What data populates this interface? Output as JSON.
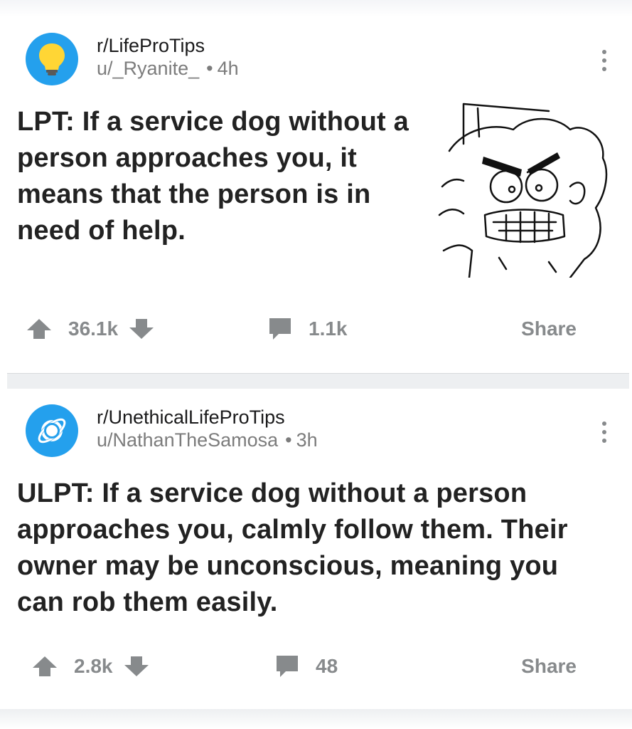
{
  "posts": [
    {
      "subreddit": "r/LifeProTips",
      "user": "u/_Ryanite_",
      "age": "4h",
      "title": "LPT: If a service dog without a person approaches you, it means that the person is in need of help.",
      "upvotes": "36.1k",
      "comments": "1.1k",
      "share_label": "Share",
      "icon": "lightbulb-icon"
    },
    {
      "subreddit": "r/UnethicalLifeProTips",
      "user": "u/NathanTheSamosa",
      "age": "3h",
      "title": "ULPT: If a service dog without a person approaches you, calmly follow them. Their owner may be unconscious, meaning you can rob them easily.",
      "upvotes": "2.8k",
      "comments": "48",
      "share_label": "Share",
      "icon": "planet-icon"
    }
  ],
  "colors": {
    "accent": "#24a0ed",
    "muted": "#878a8c",
    "bulb": "#ffd635"
  }
}
